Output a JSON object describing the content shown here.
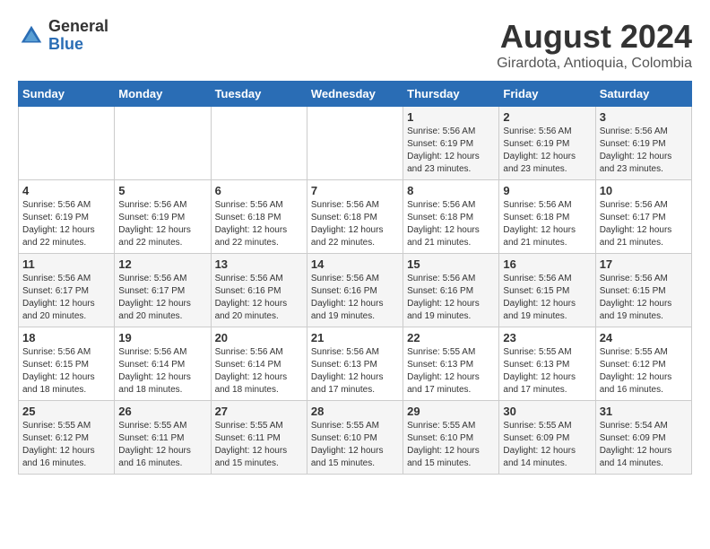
{
  "header": {
    "logo_general": "General",
    "logo_blue": "Blue",
    "main_title": "August 2024",
    "subtitle": "Girardota, Antioquia, Colombia"
  },
  "calendar": {
    "days_of_week": [
      "Sunday",
      "Monday",
      "Tuesday",
      "Wednesday",
      "Thursday",
      "Friday",
      "Saturday"
    ],
    "weeks": [
      [
        {
          "day": "",
          "info": ""
        },
        {
          "day": "",
          "info": ""
        },
        {
          "day": "",
          "info": ""
        },
        {
          "day": "",
          "info": ""
        },
        {
          "day": "1",
          "info": "Sunrise: 5:56 AM\nSunset: 6:19 PM\nDaylight: 12 hours\nand 23 minutes."
        },
        {
          "day": "2",
          "info": "Sunrise: 5:56 AM\nSunset: 6:19 PM\nDaylight: 12 hours\nand 23 minutes."
        },
        {
          "day": "3",
          "info": "Sunrise: 5:56 AM\nSunset: 6:19 PM\nDaylight: 12 hours\nand 23 minutes."
        }
      ],
      [
        {
          "day": "4",
          "info": "Sunrise: 5:56 AM\nSunset: 6:19 PM\nDaylight: 12 hours\nand 22 minutes."
        },
        {
          "day": "5",
          "info": "Sunrise: 5:56 AM\nSunset: 6:19 PM\nDaylight: 12 hours\nand 22 minutes."
        },
        {
          "day": "6",
          "info": "Sunrise: 5:56 AM\nSunset: 6:18 PM\nDaylight: 12 hours\nand 22 minutes."
        },
        {
          "day": "7",
          "info": "Sunrise: 5:56 AM\nSunset: 6:18 PM\nDaylight: 12 hours\nand 22 minutes."
        },
        {
          "day": "8",
          "info": "Sunrise: 5:56 AM\nSunset: 6:18 PM\nDaylight: 12 hours\nand 21 minutes."
        },
        {
          "day": "9",
          "info": "Sunrise: 5:56 AM\nSunset: 6:18 PM\nDaylight: 12 hours\nand 21 minutes."
        },
        {
          "day": "10",
          "info": "Sunrise: 5:56 AM\nSunset: 6:17 PM\nDaylight: 12 hours\nand 21 minutes."
        }
      ],
      [
        {
          "day": "11",
          "info": "Sunrise: 5:56 AM\nSunset: 6:17 PM\nDaylight: 12 hours\nand 20 minutes."
        },
        {
          "day": "12",
          "info": "Sunrise: 5:56 AM\nSunset: 6:17 PM\nDaylight: 12 hours\nand 20 minutes."
        },
        {
          "day": "13",
          "info": "Sunrise: 5:56 AM\nSunset: 6:16 PM\nDaylight: 12 hours\nand 20 minutes."
        },
        {
          "day": "14",
          "info": "Sunrise: 5:56 AM\nSunset: 6:16 PM\nDaylight: 12 hours\nand 19 minutes."
        },
        {
          "day": "15",
          "info": "Sunrise: 5:56 AM\nSunset: 6:16 PM\nDaylight: 12 hours\nand 19 minutes."
        },
        {
          "day": "16",
          "info": "Sunrise: 5:56 AM\nSunset: 6:15 PM\nDaylight: 12 hours\nand 19 minutes."
        },
        {
          "day": "17",
          "info": "Sunrise: 5:56 AM\nSunset: 6:15 PM\nDaylight: 12 hours\nand 19 minutes."
        }
      ],
      [
        {
          "day": "18",
          "info": "Sunrise: 5:56 AM\nSunset: 6:15 PM\nDaylight: 12 hours\nand 18 minutes."
        },
        {
          "day": "19",
          "info": "Sunrise: 5:56 AM\nSunset: 6:14 PM\nDaylight: 12 hours\nand 18 minutes."
        },
        {
          "day": "20",
          "info": "Sunrise: 5:56 AM\nSunset: 6:14 PM\nDaylight: 12 hours\nand 18 minutes."
        },
        {
          "day": "21",
          "info": "Sunrise: 5:56 AM\nSunset: 6:13 PM\nDaylight: 12 hours\nand 17 minutes."
        },
        {
          "day": "22",
          "info": "Sunrise: 5:55 AM\nSunset: 6:13 PM\nDaylight: 12 hours\nand 17 minutes."
        },
        {
          "day": "23",
          "info": "Sunrise: 5:55 AM\nSunset: 6:13 PM\nDaylight: 12 hours\nand 17 minutes."
        },
        {
          "day": "24",
          "info": "Sunrise: 5:55 AM\nSunset: 6:12 PM\nDaylight: 12 hours\nand 16 minutes."
        }
      ],
      [
        {
          "day": "25",
          "info": "Sunrise: 5:55 AM\nSunset: 6:12 PM\nDaylight: 12 hours\nand 16 minutes."
        },
        {
          "day": "26",
          "info": "Sunrise: 5:55 AM\nSunset: 6:11 PM\nDaylight: 12 hours\nand 16 minutes."
        },
        {
          "day": "27",
          "info": "Sunrise: 5:55 AM\nSunset: 6:11 PM\nDaylight: 12 hours\nand 15 minutes."
        },
        {
          "day": "28",
          "info": "Sunrise: 5:55 AM\nSunset: 6:10 PM\nDaylight: 12 hours\nand 15 minutes."
        },
        {
          "day": "29",
          "info": "Sunrise: 5:55 AM\nSunset: 6:10 PM\nDaylight: 12 hours\nand 15 minutes."
        },
        {
          "day": "30",
          "info": "Sunrise: 5:55 AM\nSunset: 6:09 PM\nDaylight: 12 hours\nand 14 minutes."
        },
        {
          "day": "31",
          "info": "Sunrise: 5:54 AM\nSunset: 6:09 PM\nDaylight: 12 hours\nand 14 minutes."
        }
      ]
    ]
  }
}
